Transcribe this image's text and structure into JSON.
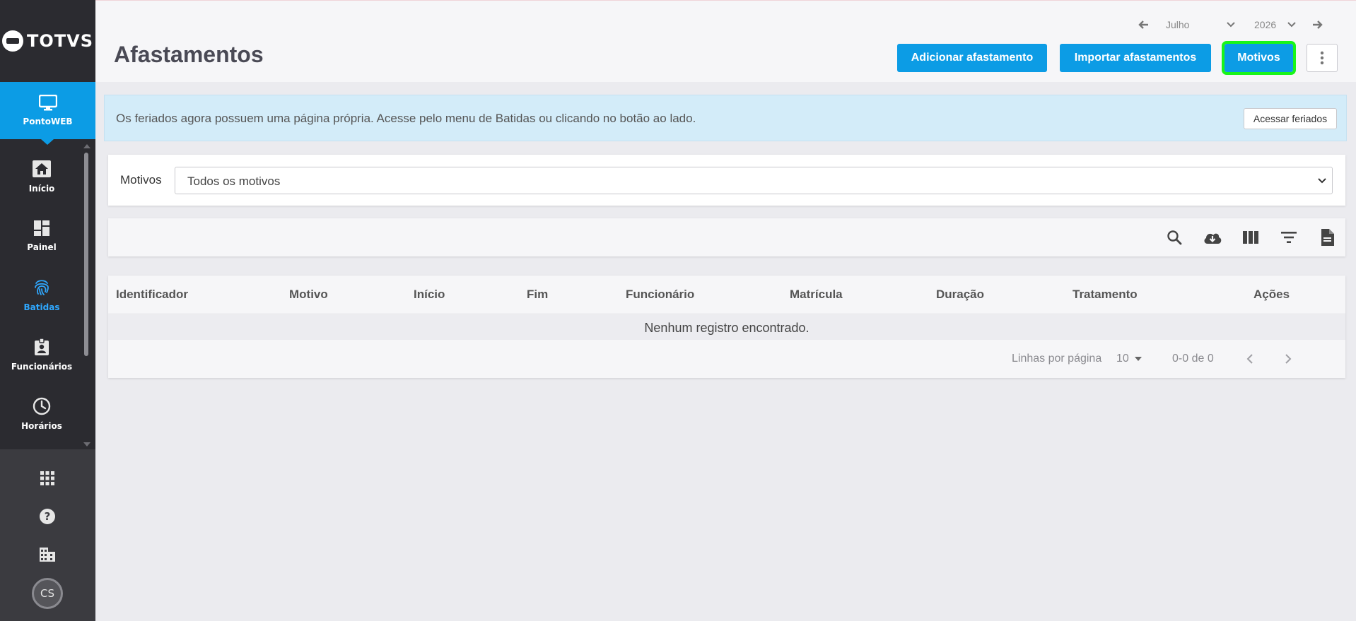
{
  "app": {
    "brand": "TOTVS",
    "module_label": "PontoWEB"
  },
  "sidebar": {
    "items": [
      {
        "label": "Início",
        "icon": "home-icon"
      },
      {
        "label": "Painel",
        "icon": "dashboard-icon"
      },
      {
        "label": "Batidas",
        "icon": "fingerprint-icon",
        "active": true
      },
      {
        "label": "Funcionários",
        "icon": "badge-icon"
      },
      {
        "label": "Horários",
        "icon": "clock-icon"
      }
    ],
    "bottom_icons": [
      "apps-grid-icon",
      "help-icon",
      "building-icon"
    ],
    "avatar_initials": "CS"
  },
  "header": {
    "title": "Afastamentos",
    "month": "Julho",
    "year": "2026",
    "buttons": {
      "add": "Adicionar afastamento",
      "import": "Importar afastamentos",
      "motivos": "Motivos"
    }
  },
  "banner": {
    "text": "Os feriados agora possuem uma página própria. Acesse pelo menu de Batidas ou clicando no botão ao lado.",
    "button": "Acessar feriados"
  },
  "filter": {
    "label": "Motivos",
    "selected": "Todos os motivos"
  },
  "toolbar": {
    "icons": [
      "search-icon",
      "cloud-download-icon",
      "columns-icon",
      "filter-icon",
      "document-icon"
    ]
  },
  "table": {
    "columns": [
      "Identificador",
      "Motivo",
      "Início",
      "Fim",
      "Funcionário",
      "Matrícula",
      "Duração",
      "Tratamento",
      "Ações"
    ],
    "empty_message": "Nenhum registro encontrado.",
    "pagination": {
      "rows_label": "Linhas por página",
      "rows_per_page": "10",
      "range": "0-0 de 0"
    }
  },
  "colors": {
    "sidebar_bg": "#2b2b30",
    "accent": "#0c9ce5",
    "active_nav": "#2fa8ff",
    "highlight_outline": "#19f519",
    "banner_bg": "#d3ecf9"
  }
}
